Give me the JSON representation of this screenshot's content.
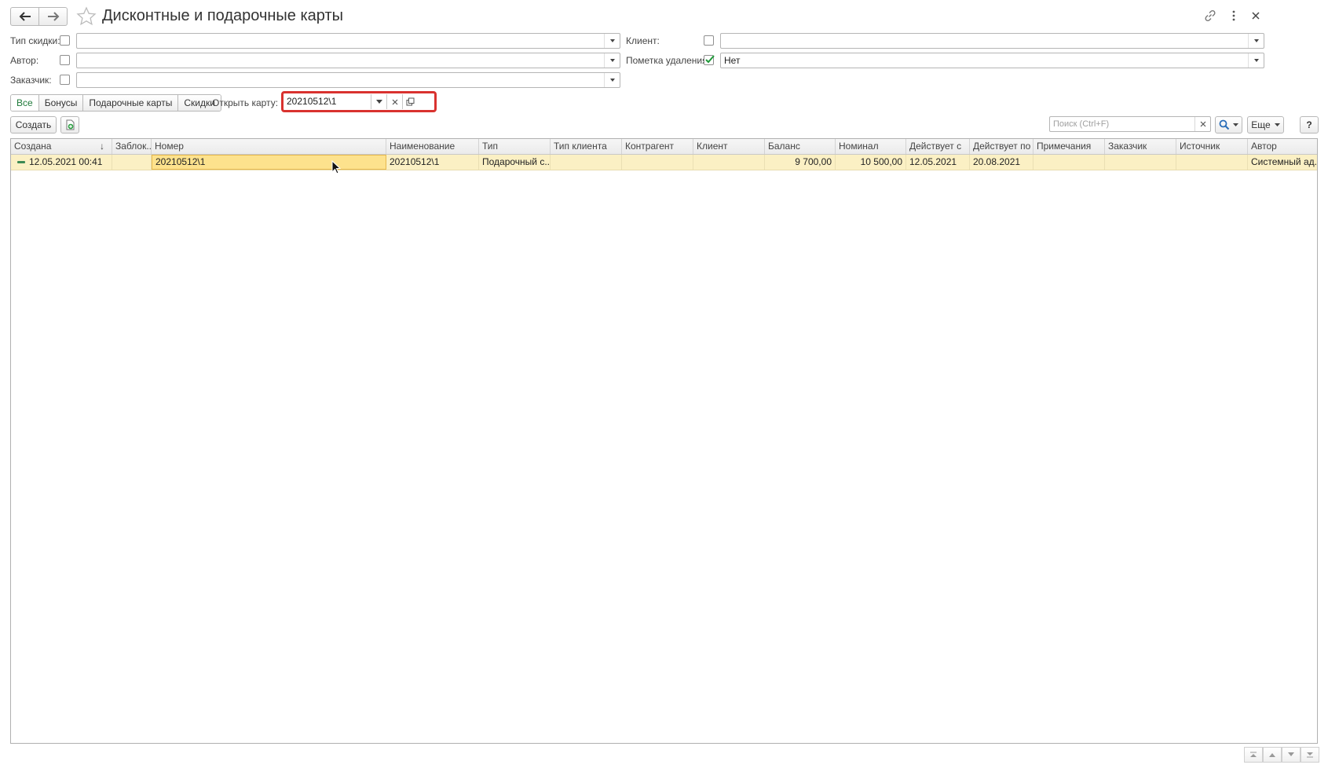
{
  "window": {
    "title": "Дисконтные и подарочные карты",
    "colors": {
      "accent_green": "#1f7a3a",
      "highlight_red": "#d9322f",
      "row_highlight": "#fbf0c4"
    }
  },
  "header": {
    "icons": [
      "back-arrow-icon",
      "forward-arrow-icon",
      "star-icon",
      "link-icon",
      "more-vertical-icon",
      "close-icon"
    ]
  },
  "filters": {
    "discount_type": {
      "label": "Тип скидки:",
      "checked": false,
      "value": ""
    },
    "author": {
      "label": "Автор:",
      "checked": false,
      "value": ""
    },
    "customer": {
      "label": "Заказчик:",
      "checked": false,
      "value": ""
    },
    "client": {
      "label": "Клиент:",
      "checked": false,
      "value": ""
    },
    "deletion_mark": {
      "label": "Пометка удаления:",
      "checked": true,
      "value": "Нет"
    }
  },
  "tabs": [
    {
      "label": "Все",
      "active": true
    },
    {
      "label": "Бонусы",
      "active": false
    },
    {
      "label": "Подарочные карты",
      "active": false
    },
    {
      "label": "Скидки",
      "active": false
    }
  ],
  "open_card": {
    "label": "Открыть карту:",
    "value": "20210512\\1"
  },
  "toolbar": {
    "create_label": "Создать",
    "search_placeholder": "Поиск (Ctrl+F)",
    "more_label": "Еще",
    "help_label": "?"
  },
  "table": {
    "columns": [
      "Создана",
      "Заблок...",
      "Номер",
      "Наименование",
      "Тип",
      "Тип клиента",
      "Контрагент",
      "Клиент",
      "Баланс",
      "Номинал",
      "Действует с",
      "Действует по",
      "Примечания",
      "Заказчик",
      "Источник",
      "Автор"
    ],
    "sort_indicator": "↓",
    "rows": [
      {
        "created": "12.05.2021 00:41",
        "blocked": "",
        "number": "20210512\\1",
        "name": "20210512\\1",
        "type": "Подарочный с...",
        "client_type": "",
        "counterparty": "",
        "client": "",
        "balance": "9 700,00",
        "nominal": "10 500,00",
        "valid_from": "12.05.2021",
        "valid_to": "20.08.2021",
        "notes": "",
        "customer": "",
        "source": "",
        "author": "Системный ад..."
      }
    ]
  }
}
